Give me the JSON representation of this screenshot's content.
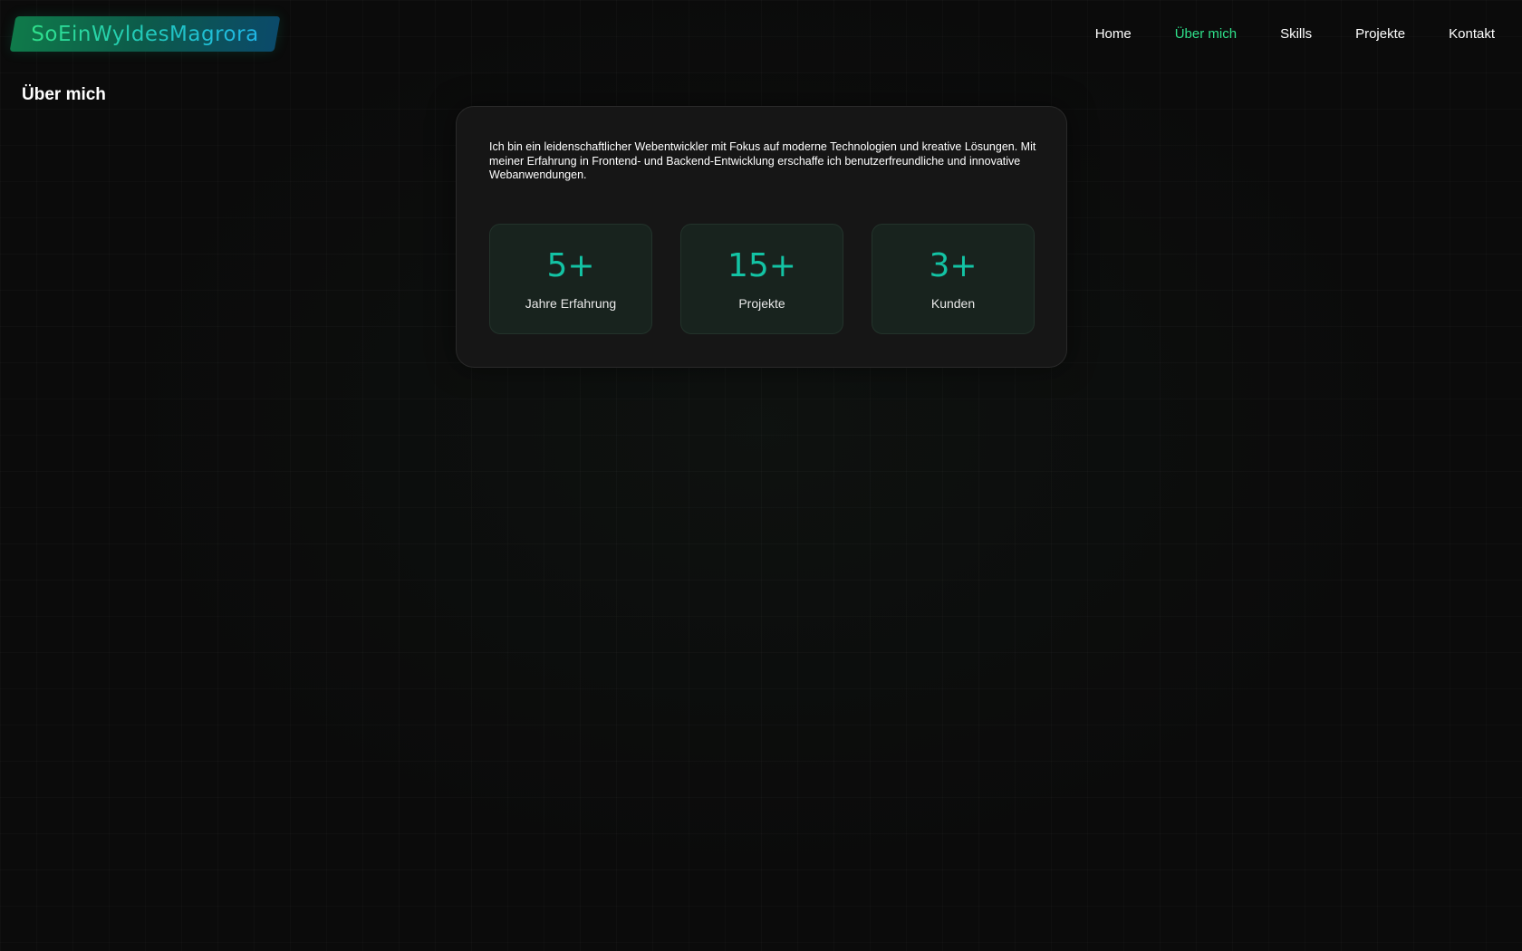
{
  "header": {
    "logo_text": "SoEinWyldesMagrora",
    "nav": [
      {
        "label": "Home",
        "active": false
      },
      {
        "label": "Über mich",
        "active": true
      },
      {
        "label": "Skills",
        "active": false
      },
      {
        "label": "Projekte",
        "active": false
      },
      {
        "label": "Kontakt",
        "active": false
      }
    ]
  },
  "about": {
    "title": "Über mich",
    "text": "Ich bin ein leidenschaftlicher Webentwickler mit Fokus auf moderne Technologien und kreative Lösungen. Mit meiner Erfahrung in Frontend- und Backend-Entwicklung erschaffe ich benutzerfreundliche und innovative Webanwendungen.",
    "stats": [
      {
        "value": "5+",
        "label": "Jahre Erfahrung"
      },
      {
        "value": "15+",
        "label": "Projekte"
      },
      {
        "value": "3+",
        "label": "Kunden"
      }
    ]
  },
  "colors": {
    "background": "#0b0b0b",
    "accent_green": "#2fe08a",
    "accent_teal": "#13c3a4",
    "accent_blue": "#1fb6e8",
    "card_bg": "#161616"
  }
}
